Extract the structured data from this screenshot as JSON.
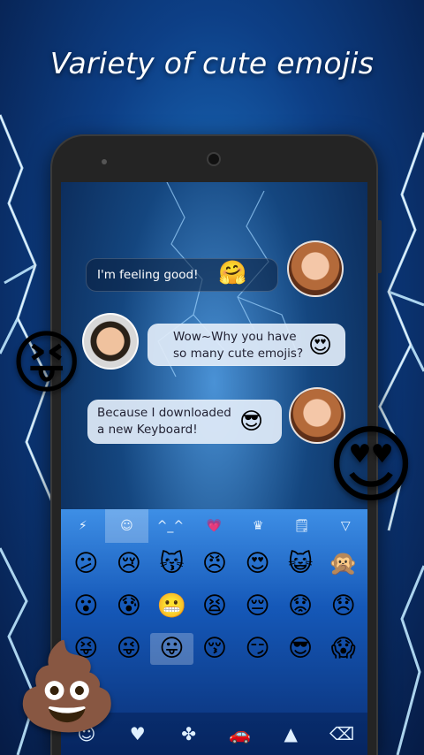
{
  "headline": "Variety of cute emojis",
  "chat": {
    "msg1": "I'm feeling good!",
    "msg1_emoji": "🤗",
    "msg2_line1": "Wow~Why you have",
    "msg2_line2": "so many cute emojis?",
    "msg2_emoji": "😍",
    "msg3_line1": "Because I downloaded",
    "msg3_line2": "a new Keyboard!",
    "msg3_emoji": "😎"
  },
  "keyboard": {
    "tabs": [
      "⚡",
      "☺",
      "^_^",
      "💗",
      "♛",
      "🗒",
      "▽"
    ],
    "rows": [
      [
        "😕",
        "😢",
        "😽",
        "😠",
        "😍",
        "😺",
        "🙊"
      ],
      [
        "😮",
        "😰",
        "😬",
        "😫",
        "😔",
        "😟",
        "😞"
      ],
      [
        "😝",
        "😜",
        "😛",
        "😚",
        "😏",
        "😎",
        "😱"
      ]
    ],
    "bottom": [
      "☺",
      "♥",
      "✤",
      "🚗",
      "▲",
      "⌫"
    ]
  },
  "decor": {
    "left_emoji": "😝",
    "right_emoji": "😍",
    "bottom_emoji": "💩"
  },
  "colors": {
    "accent": "#1f77c9",
    "bubble_light": "#e1ebf8"
  }
}
